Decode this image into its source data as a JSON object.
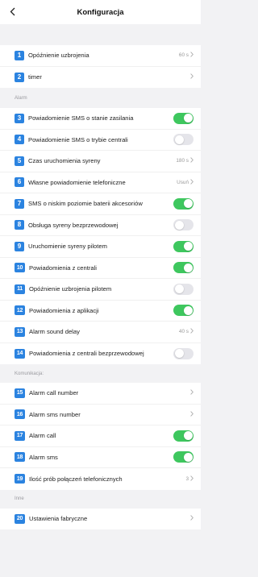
{
  "header": {
    "title": "Konfiguracja",
    "back_icon": "chevron-left-icon"
  },
  "colors": {
    "badge": "#2b83e0",
    "toggle_on": "#3ec75e",
    "toggle_off": "#e5e5ea"
  },
  "groups": [
    {
      "header": "",
      "items": [
        {
          "num": "1",
          "label": "Opóźnienie uzbrojenia",
          "type": "value",
          "value": "60 s"
        },
        {
          "num": "2",
          "label": "timer",
          "type": "chevron",
          "value": ""
        }
      ]
    },
    {
      "header": "Alarm",
      "items": [
        {
          "num": "3",
          "label": "Powiadomienie SMS o stanie zasilania",
          "type": "toggle",
          "on": true
        },
        {
          "num": "4",
          "label": "Powiadomienie SMS o trybie centrali",
          "type": "toggle",
          "on": false
        },
        {
          "num": "5",
          "label": "Czas uruchomienia syreny",
          "type": "value",
          "value": "180 s"
        },
        {
          "num": "6",
          "label": "Własne powiadomienie telefoniczne",
          "type": "value",
          "value": "Usuń"
        },
        {
          "num": "7",
          "label": "SMS o niskim poziomie baterii akcesoriów",
          "type": "toggle",
          "on": true
        },
        {
          "num": "8",
          "label": "Obsługa syreny bezprzewodowej",
          "type": "toggle",
          "on": false
        },
        {
          "num": "9",
          "label": "Uruchomienie syreny pilotem",
          "type": "toggle",
          "on": true
        },
        {
          "num": "10",
          "label": "Powiadomienia z centrali",
          "type": "toggle",
          "on": true
        },
        {
          "num": "11",
          "label": "Opóźnienie uzbrojenia pilotem",
          "type": "toggle",
          "on": false
        },
        {
          "num": "12",
          "label": "Powiadomienia z aplikacji",
          "type": "toggle",
          "on": true
        },
        {
          "num": "13",
          "label": "Alarm sound delay",
          "type": "value",
          "value": "40 s"
        },
        {
          "num": "14",
          "label": "Powiadomienia z centrali bezprzewodowej",
          "type": "toggle",
          "on": false
        }
      ]
    },
    {
      "header": "Komunikacja:",
      "items": [
        {
          "num": "15",
          "label": "Alarm call number",
          "type": "chevron",
          "value": ""
        },
        {
          "num": "16",
          "label": "Alarm sms number",
          "type": "chevron",
          "value": ""
        },
        {
          "num": "17",
          "label": "Alarm call",
          "type": "toggle",
          "on": true
        },
        {
          "num": "18",
          "label": "Alarm sms",
          "type": "toggle",
          "on": true
        },
        {
          "num": "19",
          "label": "Ilość prób połączeń telefonicznych",
          "type": "value",
          "value": "3"
        }
      ]
    },
    {
      "header": "Inne",
      "items": [
        {
          "num": "20",
          "label": "Ustawienia fabryczne",
          "type": "chevron",
          "value": ""
        }
      ]
    }
  ]
}
